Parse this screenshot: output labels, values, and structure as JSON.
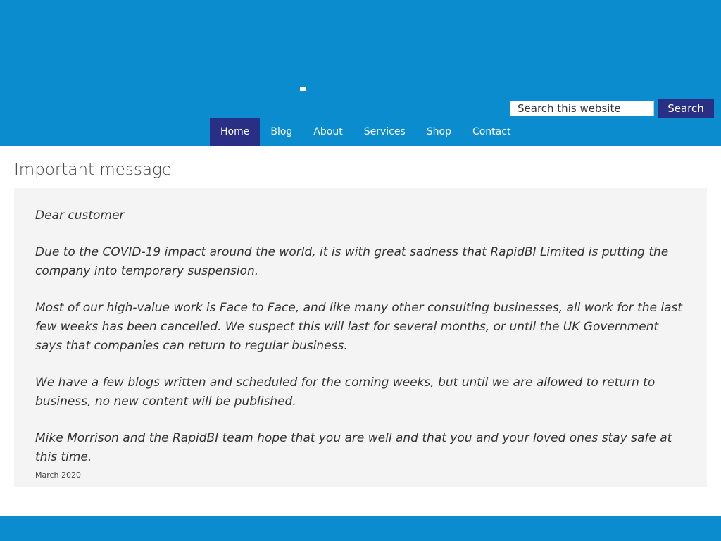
{
  "header": {
    "colors": {
      "background": "#0a8ccf",
      "accent": "#2a2f86"
    },
    "icon": "mail-icon"
  },
  "search": {
    "placeholder": "Search this website",
    "button_label": "Search"
  },
  "nav": {
    "items": [
      {
        "label": "Home",
        "active": true
      },
      {
        "label": "Blog"
      },
      {
        "label": "About"
      },
      {
        "label": "Services"
      },
      {
        "label": "Shop"
      },
      {
        "label": "Contact"
      }
    ]
  },
  "main": {
    "title": "Important message",
    "paragraphs": [
      "Dear customer",
      "Due to the COVID-19 impact around the world, it is with great sadness that RapidBI Limited is putting the company into temporary suspension.",
      "Most of our high-value work is Face to Face, and like many other consulting businesses, all work for the last few weeks has been cancelled. We suspect this will last for several months, or until the UK Government says that companies can return to regular business.",
      "We have a few blogs written and scheduled for the coming weeks, but until we are allowed to return to business, no new content will be published.",
      "Mike Morrison and the RapidBI team hope that you are well and that you and your loved ones stay safe at this time."
    ],
    "date": "March 2020"
  }
}
